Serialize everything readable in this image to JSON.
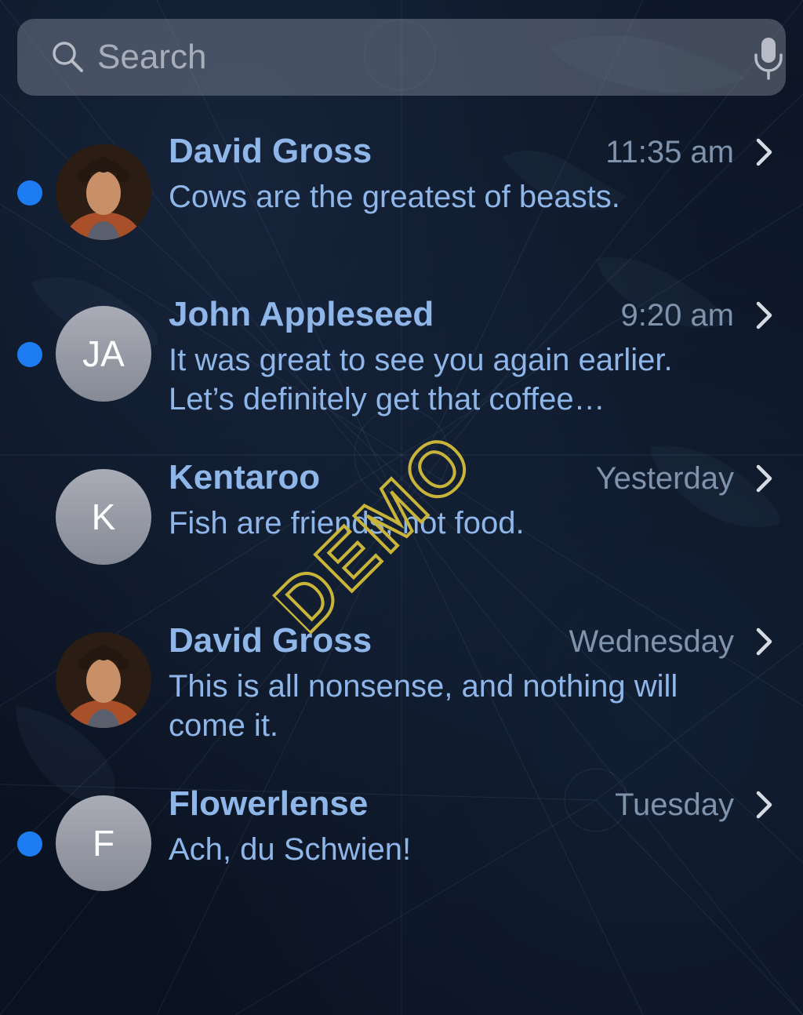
{
  "search": {
    "placeholder": "Search",
    "icon": "search-icon",
    "mic_icon": "microphone-icon"
  },
  "conversations": [
    {
      "name": "David Gross",
      "time": "11:35 am",
      "preview": "Cows are the greatest of beasts.",
      "unread": true,
      "avatar": "photo"
    },
    {
      "name": "John Appleseed",
      "time": "9:20 am",
      "preview": "It was great to see you again earlier. Let’s definitely get that coffee…",
      "unread": true,
      "avatar": "JA"
    },
    {
      "name": "Kentaroo",
      "time": "Yesterday",
      "preview": "Fish are friends, not food.",
      "unread": false,
      "avatar": "K"
    },
    {
      "name": "David Gross",
      "time": "Wednesday",
      "preview": "This is all nonsense, and nothing will come it.",
      "unread": false,
      "avatar": "photo"
    },
    {
      "name": "Flowerlense",
      "time": "Tuesday",
      "preview": "Ach, du Schwien!",
      "unread": true,
      "avatar": "F"
    }
  ],
  "watermark": "DEMO",
  "colors": {
    "unread_dot": "#1e7cf2",
    "name_text": "#8eb6e9",
    "time_text": "#7f93ad",
    "watermark": "#c9b43a"
  }
}
